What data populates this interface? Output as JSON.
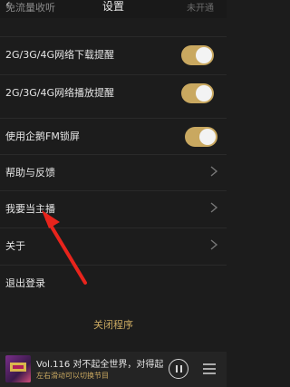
{
  "header": {
    "title": "设置",
    "partial_row_label": "免流量收听",
    "partial_row_value": "未开通"
  },
  "settings": [
    {
      "label": "2G/3G/4G网络下载提醒",
      "type": "toggle",
      "on": true
    },
    {
      "label": "2G/3G/4G网络播放提醒",
      "type": "toggle",
      "on": true
    },
    {
      "label": "使用企鹅FM锁屏",
      "type": "toggle",
      "on": true
    },
    {
      "label": "帮助与反馈",
      "type": "link"
    },
    {
      "label": "我要当主播",
      "type": "link"
    },
    {
      "label": "关于",
      "type": "link"
    },
    {
      "label": "退出登录",
      "type": "action"
    }
  ],
  "close_label": "关闭程序",
  "player": {
    "title": "Vol.116 对不起全世界，对得起...",
    "subtitle": "左右滑动可以切换节目"
  },
  "colors": {
    "accent": "#c9a860",
    "background": "#1c1c1c",
    "arrow": "#e8241c"
  }
}
